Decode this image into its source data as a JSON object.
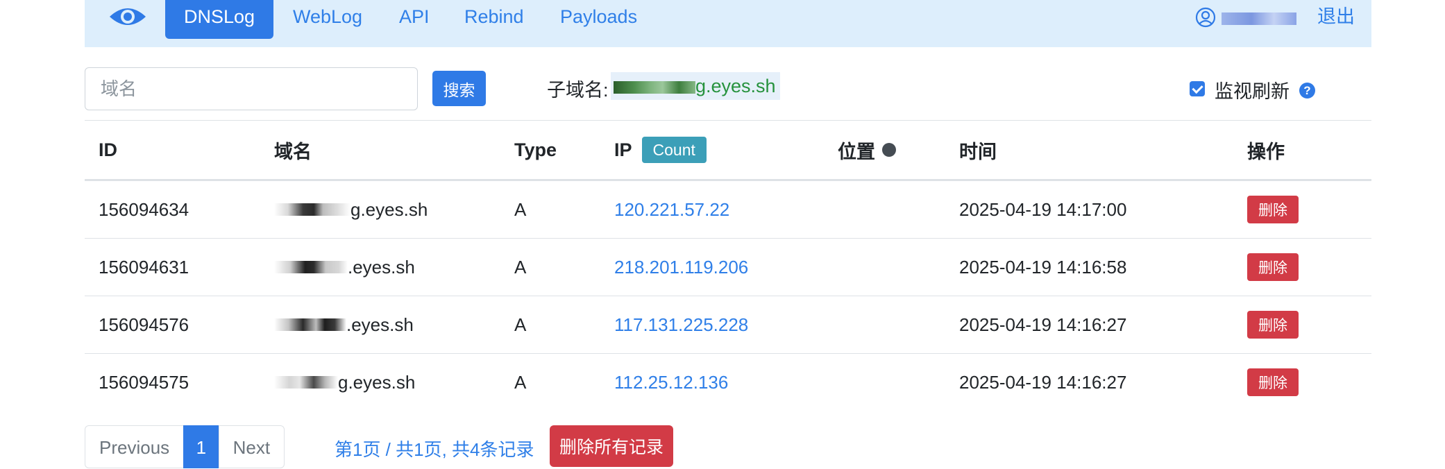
{
  "nav": {
    "logo_icon": "eye-icon",
    "items": [
      {
        "label": "DNSLog",
        "active": true
      },
      {
        "label": "WebLog",
        "active": false
      },
      {
        "label": "API",
        "active": false
      },
      {
        "label": "Rebind",
        "active": false
      },
      {
        "label": "Payloads",
        "active": false
      }
    ],
    "user": {
      "icon": "user-circle-icon",
      "name": "93y10rg"
    },
    "logout_label": "退出"
  },
  "search": {
    "placeholder": "域名",
    "button_label": "搜索"
  },
  "subdomain": {
    "label": "子域名:",
    "value_masked": "93y10rg",
    "value_suffix": "g.eyes.sh"
  },
  "monitor": {
    "label": "监视刷新",
    "checked": true,
    "help_icon": "question-circle-icon",
    "help_glyph": "?"
  },
  "table": {
    "headers": {
      "id": "ID",
      "domain": "域名",
      "type": "Type",
      "ip": "IP",
      "count_badge": "Count",
      "location": "位置",
      "time": "时间",
      "action": "操作"
    },
    "rows": [
      {
        "id": "156094634",
        "domain_masked": "93y10r",
        "domain_suffix": "g.eyes.sh",
        "type": "A",
        "ip": "120.221.57.22",
        "location": "",
        "time": "2025-04-19 14:17:00",
        "action": "删除"
      },
      {
        "id": "156094631",
        "domain_masked": "93y10r",
        "domain_suffix": ".eyes.sh",
        "type": "A",
        "ip": "218.201.119.206",
        "location": "",
        "time": "2025-04-19 14:16:58",
        "action": "删除"
      },
      {
        "id": "156094576",
        "domain_masked": "93y10r",
        "domain_suffix": ".eyes.sh",
        "type": "A",
        "ip": "117.131.225.228",
        "location": "",
        "time": "2025-04-19 14:16:27",
        "action": "删除"
      },
      {
        "id": "156094575",
        "domain_masked": "93y10",
        "domain_suffix": "g.eyes.sh",
        "type": "A",
        "ip": "112.25.12.136",
        "location": "",
        "time": "2025-04-19 14:16:27",
        "action": "删除"
      }
    ]
  },
  "pagination": {
    "previous": "Previous",
    "current": "1",
    "next": "Next",
    "info": "第1页 / 共1页, 共4条记录",
    "delete_all": "删除所有记录"
  },
  "colors": {
    "primary": "#2f7ae6",
    "link": "#2f7fe8",
    "danger": "#d23b46",
    "info_badge": "#3c9fb8",
    "navbar_bg": "#ddeefc",
    "subdomain_text": "#26923d"
  }
}
